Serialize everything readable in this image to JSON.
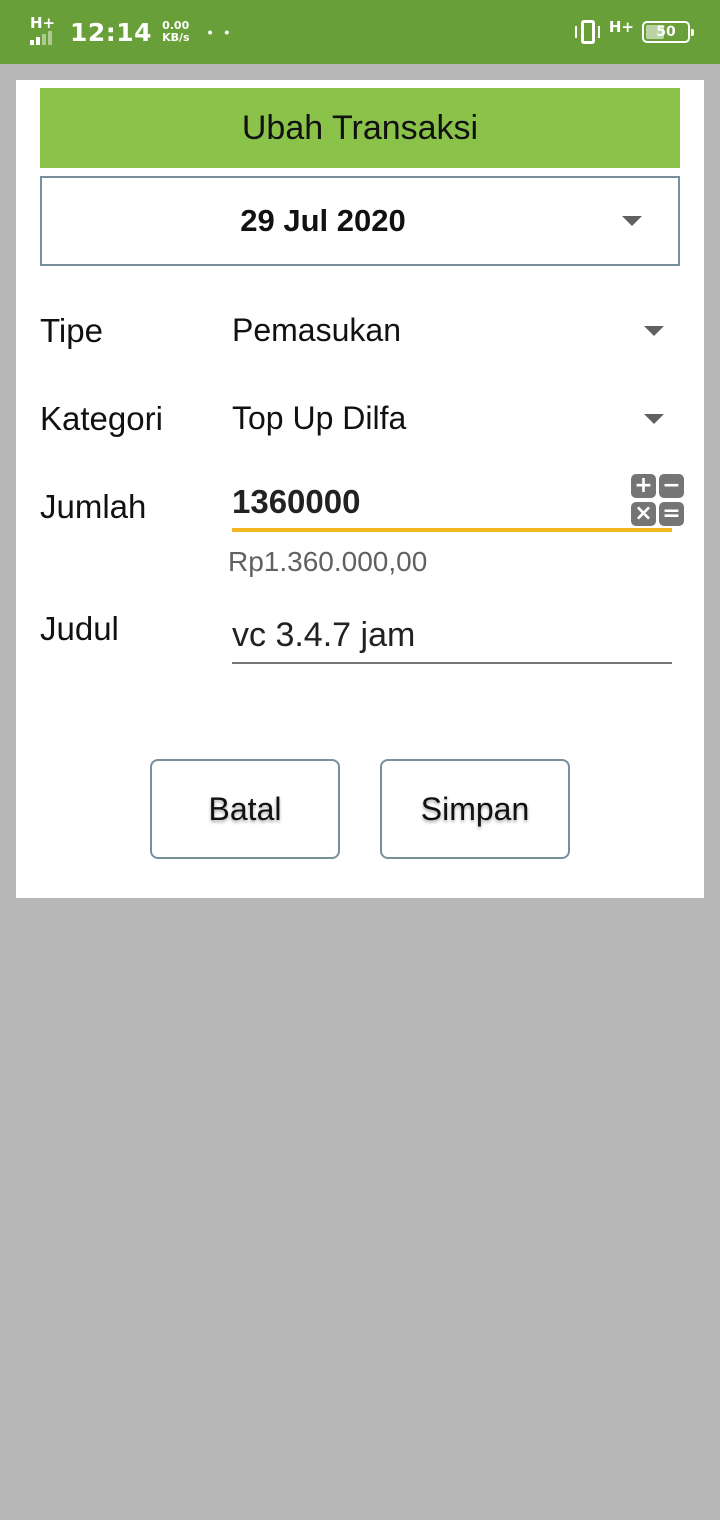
{
  "status_bar": {
    "network_left": "H+",
    "time": "12:14",
    "speed_value": "0.00",
    "speed_unit": "KB/s",
    "dots": "• •",
    "network_right": "H+",
    "battery_level": "50",
    "battery_fraction": 0.5
  },
  "dialog": {
    "title": "Ubah Transaksi",
    "date": "29 Jul 2020",
    "type_label": "Tipe",
    "type_value": "Pemasukan",
    "category_label": "Kategori",
    "category_value": "Top Up Dilfa",
    "amount_label": "Jumlah",
    "amount_value": "1360000",
    "amount_formatted": "Rp1.360.000,00",
    "calc_keys": [
      "+",
      "−",
      "×",
      "="
    ],
    "title_label": "Judul",
    "title_value": "vc 3.4.7 jam",
    "cancel_label": "Batal",
    "save_label": "Simpan"
  },
  "colors": {
    "status_bar": "#689f38",
    "header": "#8bc34a",
    "amount_underline": "#f2b51e",
    "overlay": "#b8b8b8"
  }
}
